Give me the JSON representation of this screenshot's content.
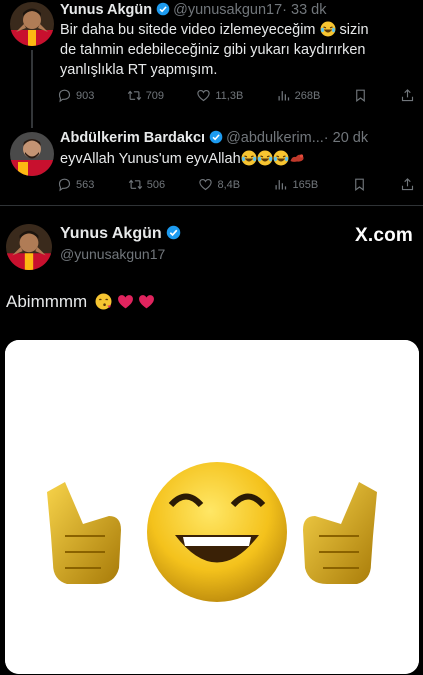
{
  "tweets": [
    {
      "name": "Yunus Akgün",
      "handle": "@yunusakgun17",
      "time": "· 33 dk",
      "lines": [
        "Bir daha bu sitede video izlemeyeceğim",
        " sizin",
        "de tahmin edebileceğiniz gibi yukarı kaydırırken",
        "yanlışlıkla RT yapmışım."
      ],
      "stats": {
        "replies": "903",
        "retweets": "709",
        "likes": "11,3B",
        "views": "268B"
      }
    },
    {
      "name": "Abdülkerim Bardakcı",
      "handle": "@abdulkerim...",
      "time": "· 20 dk",
      "text": "eyvAllah Yunus'um eyvAllah",
      "stats": {
        "replies": "563",
        "retweets": "506",
        "likes": "8,4B",
        "views": "165B"
      }
    }
  ],
  "quote": {
    "name": "Yunus Akgün",
    "handle": "@yunusakgun17",
    "brand": "X.com",
    "text": "Abimmmm"
  },
  "icons": [
    "verified-badge-icon",
    "reply-icon",
    "retweet-icon",
    "like-icon",
    "views-icon",
    "bookmark-icon",
    "share-icon",
    "laughing-emoji-icon",
    "red-heart-icon",
    "flexed-biceps-emoji-icon"
  ],
  "colors": {
    "background": "#000000",
    "text": "#e7e9ea",
    "muted": "#71767b",
    "verified": "#1d9bf0",
    "team_red": "#c8102e",
    "team_yellow": "#fdb912"
  }
}
